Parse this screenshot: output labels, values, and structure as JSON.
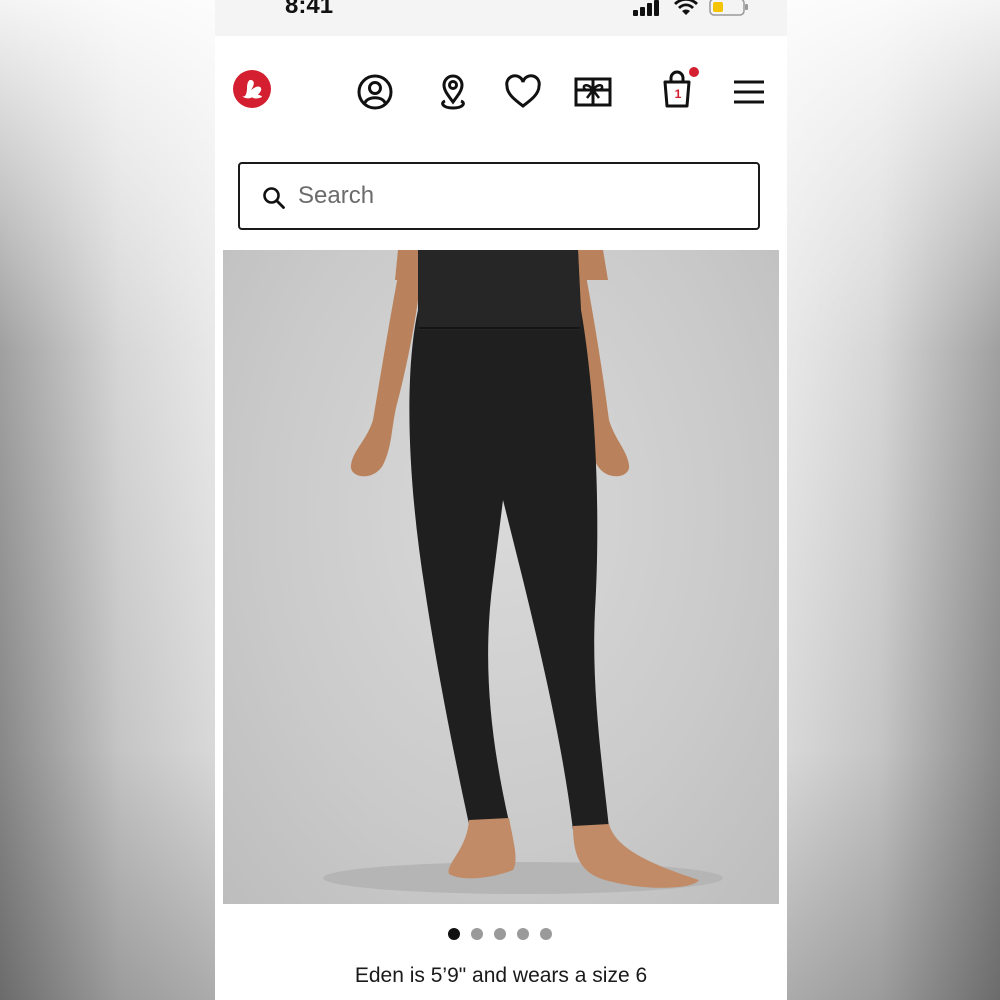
{
  "status_bar": {
    "time": "8:41"
  },
  "header": {
    "icons": [
      "logo-icon",
      "account-icon",
      "location-icon",
      "heart-icon",
      "gift-icon",
      "bag-icon",
      "menu-icon"
    ],
    "bag_count": "1",
    "brand_color": "#d31f2f"
  },
  "search": {
    "placeholder": "Search",
    "value": ""
  },
  "product": {
    "image": "black high-rise leggings on model",
    "carousel": {
      "total": 5,
      "active": 1
    },
    "model_caption": "Eden is 5’9\" and wears a size 6"
  }
}
